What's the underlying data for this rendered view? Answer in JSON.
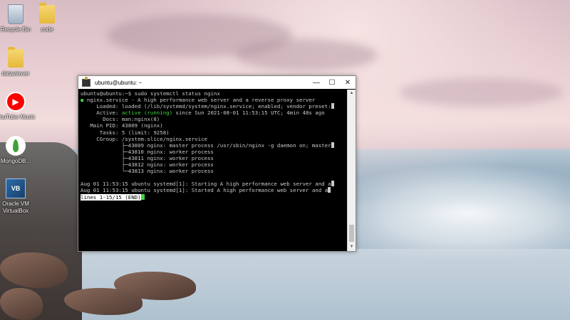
{
  "desktop": {
    "icons": [
      {
        "label": "Recycle Bin"
      },
      {
        "label": "code"
      },
      {
        "label": "dataviewer"
      },
      {
        "label": "YouTube Music"
      },
      {
        "label": "MongoDB..."
      },
      {
        "label": "Oracle VM VirtualBox"
      }
    ]
  },
  "window": {
    "title": "ubuntu@ubuntu: ~",
    "controls": {
      "minimize": "—",
      "maximize": "☐",
      "close": "✕"
    }
  },
  "terminal": {
    "prompt": "ubuntu@ubuntu:~$ ",
    "command": "sudo systemctl status nginx",
    "service_line": " nginx.service - A high performance web server and a reverse proxy server",
    "service_dot": "●",
    "loaded": "     Loaded: loaded (/lib/systemd/system/nginx.service; enabled; vendor preset:",
    "active_label": "     Active: ",
    "active_state": "active (running)",
    "active_rest": " since Sun 2021-08-01 11:53:15 UTC; 4min 48s ago",
    "docs": "       Docs: man:nginx(8)",
    "main_pid": "   Main PID: 43809 (nginx)",
    "tasks": "      Tasks: 5 (limit: 9258)",
    "cgroup": "     CGroup: /system.slice/nginx.service",
    "processes": [
      "             ├─43809 nginx: master process /usr/sbin/nginx -g daemon on; master",
      "             ├─43810 nginx: worker process",
      "             ├─43811 nginx: worker process",
      "             ├─43812 nginx: worker process",
      "             └─43813 nginx: worker process"
    ],
    "log": [
      "Aug 01 11:53:15 ubuntu systemd[1]: Starting A high performance web server and a",
      "Aug 01 11:53:15 ubuntu systemd[1]: Started A high performance web server and a"
    ],
    "pager_status": "lines 1-15/15 (END)"
  }
}
